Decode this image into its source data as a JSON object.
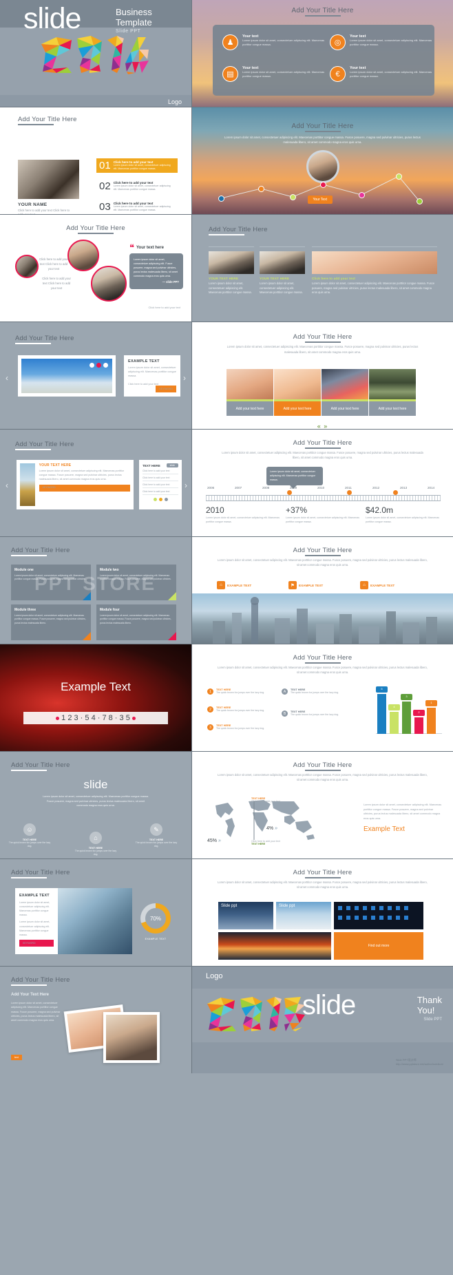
{
  "cover": {
    "brand": "slide",
    "business": "Business\nTemplate",
    "sub": "Slide PPT",
    "year": "2014",
    "logo": "Logo"
  },
  "common": {
    "title": "Add Your Title Here",
    "lorem_long": "Lorem ipsum dolor sit amet, consectetuer adipiscing elit. Maecenas porttitor congue massa. Fusce posuere, magna sed pulvinar ultricies, purus lectus malesuada libero, sit amet commodo magna eros quis urna.",
    "lorem_short": "Lorem ipsum dolor sit amet, consectetuer adipiscing elit. Maecenas porttitor congue massa.",
    "click_add": "Click here to add your text",
    "your_text": "Your Text",
    "keyword": "KEYWORD"
  },
  "slide_icons": {
    "items": [
      {
        "label": "Your text",
        "body": "Lorem ipsum dolor sit amet, consectetuer adipiscing elit. Maecenas porttitor congue massa.",
        "icon": "podium-icon",
        "glyph": "♟"
      },
      {
        "label": "Your text",
        "body": "Lorem ipsum dolor sit amet, consectetuer adipiscing elit. Maecenas porttitor congue massa.",
        "icon": "target-icon",
        "glyph": "◎"
      },
      {
        "label": "Your text",
        "body": "Lorem ipsum dolor sit amet, consectetuer adipiscing elit. Maecenas porttitor congue massa.",
        "icon": "presentation-icon",
        "glyph": "▤"
      },
      {
        "label": "Your text",
        "body": "Lorem ipsum dolor sit amet, consectetuer adipiscing elit. Maecenas porttitor congue massa.",
        "icon": "money-icon",
        "glyph": "€"
      }
    ]
  },
  "numbered": {
    "name": "YOUR NAME",
    "name_body": "Click here to add your text Click here to add your text",
    "rows": [
      {
        "num": "01",
        "head": "Click here to add your text",
        "body": "Lorem ipsum dolor sit amet, consectetuer adipiscing elit. Maecenas porttitor congue massa."
      },
      {
        "num": "02",
        "head": "Click here to add your text",
        "body": "Lorem ipsum dolor sit amet, consectetuer adipiscing elit. Maecenas porttitor congue massa."
      },
      {
        "num": "03",
        "head": "Click here to add your text",
        "body": "Lorem ipsum dolor sit amet, consectetuer adipiscing elit. Maecenas porttitor congue massa."
      }
    ],
    "social": [
      "facebook-icon",
      "twitter-icon",
      "rss-icon",
      "google-icon",
      "flickr-icon"
    ]
  },
  "quote": {
    "heading": "Your text here",
    "mark": "❝",
    "body": "Lorem ipsum dolor sit amet, consectetuer adipiscing elit. Fusce posuere, magna sed pulvinar ultricies, purus lectus malesuada libero, sit amet commodo magna eros quis urna.",
    "ppt": "— slide PPT",
    "caption": "Click here to add your text",
    "cap_left": "Click here to add your text Click here to add your text",
    "cap_mid": "Click here to add your text Click here to add your text",
    "cap_top": "Click here to add your text Click here to add your text"
  },
  "cards3": {
    "items": [
      {
        "head": "YOUR TEXT HERE",
        "body": "Lorem ipsum dolor sit amet, consectetuer adipiscing elit. Maecenas porttitor congue massa."
      },
      {
        "head": "YOUR TEXT HERE",
        "body": "Lorem ipsum dolor sit amet, consectetuer adipiscing elit. Maecenas porttitor congue massa."
      },
      {
        "head": "Click here to add your text",
        "body": "Lorem ipsum dolor sit amet, consectetuer adipiscing elit. Maecenas porttitor congue massa. Fusce posuere, magna sed pulvinar ultricies, purus lectus malesuada libero, sit amet commodo magna eros quis urna."
      }
    ]
  },
  "carousel": {
    "card_title": "EXAMPLE TEXT",
    "card_body": "Lorem ipsum dolor sit amet, consectetuer adipiscing elit. Maecenas porttitor congue massa.",
    "card_foot": "Click here to add your text",
    "button": "KEYWORD",
    "prev": "‹",
    "next": "›"
  },
  "tiles4": {
    "items": [
      {
        "label": "Add your text here",
        "active": false
      },
      {
        "label": "Add your text here",
        "active": true
      },
      {
        "label": "Add your text here",
        "active": false
      },
      {
        "label": "Add your text here",
        "active": false
      }
    ],
    "prev": "«",
    "next": "»"
  },
  "trophy": {
    "head": "YOUR TEXT HERE",
    "body": "Lorem ipsum dolor sit amet, consectetuer adipiscing elit. Maecenas porttitor congue massa. Fusce posuere, magna sed pulvinar ultricies, purus lectus malesuada libero, sit amet commodo magna eros quis urna.",
    "button": "KEYWORD",
    "panel_title": "TEXT HERE",
    "pill": "slide",
    "lines": [
      "Click here to add your text",
      "Click here to add your text",
      "Click here to add your text",
      "Click here to add your text"
    ],
    "dot_colors": [
      "#c9e265",
      "#f0a81e",
      "#8d99a5"
    ]
  },
  "timeline": {
    "bubble": "Lorem ipsum dolor sit amet, consectetuer adipiscing elit. Maecenas porttitor congue massa.",
    "years": [
      "2006",
      "2007",
      "2008",
      "2009",
      "2010",
      "2011",
      "2012",
      "2013",
      "2014"
    ],
    "stats": [
      {
        "value": "2010",
        "body": "Lorem ipsum dolor sit amet, consectetuer adipiscing elit. Maecenas porttitor congue massa."
      },
      {
        "value": "+37%",
        "body": "Lorem ipsum dolor sit amet, consectetuer adipiscing elit. Maecenas porttitor congue massa."
      },
      {
        "value": "$42.0m",
        "body": "Lorem ipsum dolor sit amet, consectetuer adipiscing elit. Maecenas porttitor congue massa."
      }
    ],
    "dot_positions": [
      2,
      5,
      7
    ]
  },
  "modules": {
    "items": [
      {
        "name": "Module one",
        "body": "Lorem ipsum dolor sit amet, consectetuer adipiscing elit. Maecenas porttitor congue massa. Fusce posuere, magna sed pulvinar ultricies.",
        "corner": "#1a7fc1"
      },
      {
        "name": "Module two",
        "body": "Lorem ipsum dolor sit amet, consectetuer adipiscing elit. Maecenas porttitor congue massa. Fusce posuere, magna sed pulvinar ultricies.",
        "corner": "#c9e265"
      },
      {
        "name": "Module three",
        "body": "Lorem ipsum dolor sit amet, consectetuer adipiscing elit. Maecenas porttitor congue massa. Fusce posuere, magna sed pulvinar ultricies, purus lectus malesuada libero.",
        "corner": "#f0821e"
      },
      {
        "name": "Module four",
        "body": "Lorem ipsum dolor sit amet, consectetuer adipiscing elit. Maecenas porttitor congue massa. Fusce posuere, magna sed pulvinar ultricies, purus lectus malesuada libero.",
        "corner": "#e8174e"
      }
    ],
    "watermark": "PPT STORE"
  },
  "citybar": {
    "buttons": [
      {
        "label": "EXAMPLE TEXT",
        "glyph": "⌂"
      },
      {
        "label": "EXAMPLE TEXT",
        "glyph": "⚑"
      },
      {
        "label": "EXAMPLE TEXT",
        "glyph": "⌂"
      }
    ]
  },
  "darkslide": {
    "title": "Example Text",
    "numbers": "1 2 3 · 5 4 · 7 8 · 3 5"
  },
  "chart": {
    "left_items": [
      {
        "badge": "1",
        "head": "TEXT HERE",
        "body": "The quick brown fox jumps over the lazy dog."
      },
      {
        "badge": "2",
        "head": "TEXT HERE",
        "body": "The quick brown fox jumps over the lazy dog."
      },
      {
        "badge": "3",
        "head": "TEXT HERE",
        "body": "The quick brown fox jumps over the lazy dog."
      }
    ],
    "right_items": [
      {
        "badge": "A",
        "head": "TEXT HERE",
        "body": "The quick brown fox jumps over the lazy dog."
      },
      {
        "badge": "B",
        "head": "TEXT HERE",
        "body": "The quick brown fox jumps over the lazy dog."
      }
    ]
  },
  "chart_data": {
    "type": "bar",
    "title": "Add Your Title Here",
    "categories": [
      "1",
      "2",
      "3",
      "4",
      "5"
    ],
    "values": [
      72,
      40,
      58,
      30,
      46
    ],
    "colors": [
      "#1a7fc1",
      "#c9e265",
      "#5e9e3a",
      "#e8174e",
      "#f0821e"
    ],
    "labels": [
      "5",
      "4",
      "3",
      "2",
      "1"
    ],
    "ylim": [
      0,
      80
    ],
    "grid": false,
    "legend": "none",
    "xlabel": "",
    "ylabel": ""
  },
  "iconsrow": {
    "word": "slide",
    "items": [
      {
        "glyph": "☺",
        "icon": "user-icon",
        "head": "TEXT HERE",
        "body": "The quick brown fox jumps over the lazy dog."
      },
      {
        "glyph": "⌂",
        "icon": "home-icon",
        "head": "TEXT HERE",
        "body": "The quick brown fox jumps over the lazy dog."
      },
      {
        "glyph": "✎",
        "icon": "pencil-icon",
        "head": "TEXT HERE",
        "body": "The quick brown fox jumps over the lazy dog."
      }
    ]
  },
  "map": {
    "example": "Example Text",
    "body": "Lorem ipsum dolor sit amet, consectetuer adipiscing elit. Maecenas porttitor congue massa. Fusce posuere, magna sed pulvinar ultricies, purus lectus malesuada libero, sit amet commodo magna eros quis urna.",
    "pins": [
      {
        "value": "45%",
        "arrow": "»"
      },
      {
        "value": "4%",
        "arrow": "»"
      }
    ],
    "callout": "Click here to add your text",
    "callout_link": "TEXT HERE",
    "callout_top": "TEXT HERE",
    "callout_top_body": "Click here to add your text"
  },
  "donut": {
    "title": "EXAMPLE TEXT",
    "body": "Lorem ipsum dolor sit amet, consectetuer adipiscing elit. Maecenas porttitor congue massa.",
    "body2": "Lorem ipsum dolor sit amet, consectetuer adipiscing elit. Maecenas porttitor congue massa.",
    "button": "KEYWORD",
    "percent": "70%",
    "label": "EXAMPLE TEXT"
  },
  "photogrid": {
    "tiles": [
      {
        "label": "Slide ppt"
      },
      {
        "label": "Slide ppt"
      },
      {
        "label": ""
      },
      {
        "label": ""
      }
    ],
    "cta": "Find out more"
  },
  "lastleft": {
    "subtitle": "Add Your Text Here",
    "body": "Lorem ipsum dolor sit amet, consectetuer adipiscing elit. Maecenas porttitor congue massa. Fusce posuere, magna sed pulvinar ultricies, purus lectus malesuada libero, sit amet commodo magna eros quis urna.",
    "button": "text"
  },
  "closing": {
    "logo": "Logo",
    "year": "2015",
    "brand": "slide",
    "thanks": "Thank\nYou!",
    "sub": "Slide PPT",
    "credit": "Slide PPT设计师\nhttp://www.pptstore.net/author/solution/"
  }
}
